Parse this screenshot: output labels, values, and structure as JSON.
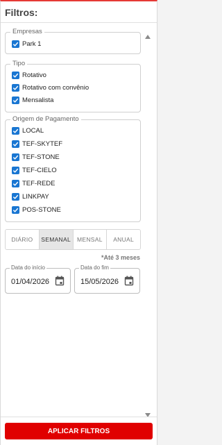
{
  "header": {
    "title": "Filtros:"
  },
  "groups": {
    "empresas": {
      "legend": "Empresas",
      "items": [
        {
          "label": "Park 1",
          "checked": true
        }
      ]
    },
    "tipo": {
      "legend": "Tipo",
      "items": [
        {
          "label": "Rotativo",
          "checked": true
        },
        {
          "label": "Rotativo com convênio",
          "checked": true
        },
        {
          "label": "Mensalista",
          "checked": true
        }
      ]
    },
    "origem": {
      "legend": "Origem de Pagamento",
      "items": [
        {
          "label": "LOCAL",
          "checked": true
        },
        {
          "label": "TEF-SKYTEF",
          "checked": true
        },
        {
          "label": "TEF-STONE",
          "checked": true
        },
        {
          "label": "TEF-CIELO",
          "checked": true
        },
        {
          "label": "TEF-REDE",
          "checked": true
        },
        {
          "label": "LINKPAY",
          "checked": true
        },
        {
          "label": "POS-STONE",
          "checked": true
        }
      ]
    }
  },
  "period": {
    "options": [
      "DIÁRIO",
      "SEMANAL",
      "MENSAL",
      "ANUAL"
    ],
    "selected": "SEMANAL",
    "hint": "*Até 3 meses"
  },
  "dates": {
    "start": {
      "label": "Data do início",
      "value": "01/04/2026"
    },
    "end": {
      "label": "Data do fim",
      "value": "15/05/2026"
    }
  },
  "footer": {
    "apply_label": "APLICAR FILTROS"
  },
  "colors": {
    "accent": "#e00000",
    "checkbox": "#1976d2"
  },
  "icons": {
    "checkbox": "checkmark-icon",
    "date": "calendar-icon",
    "scroll_up": "triangle-up-icon",
    "scroll_down": "triangle-down-icon"
  }
}
